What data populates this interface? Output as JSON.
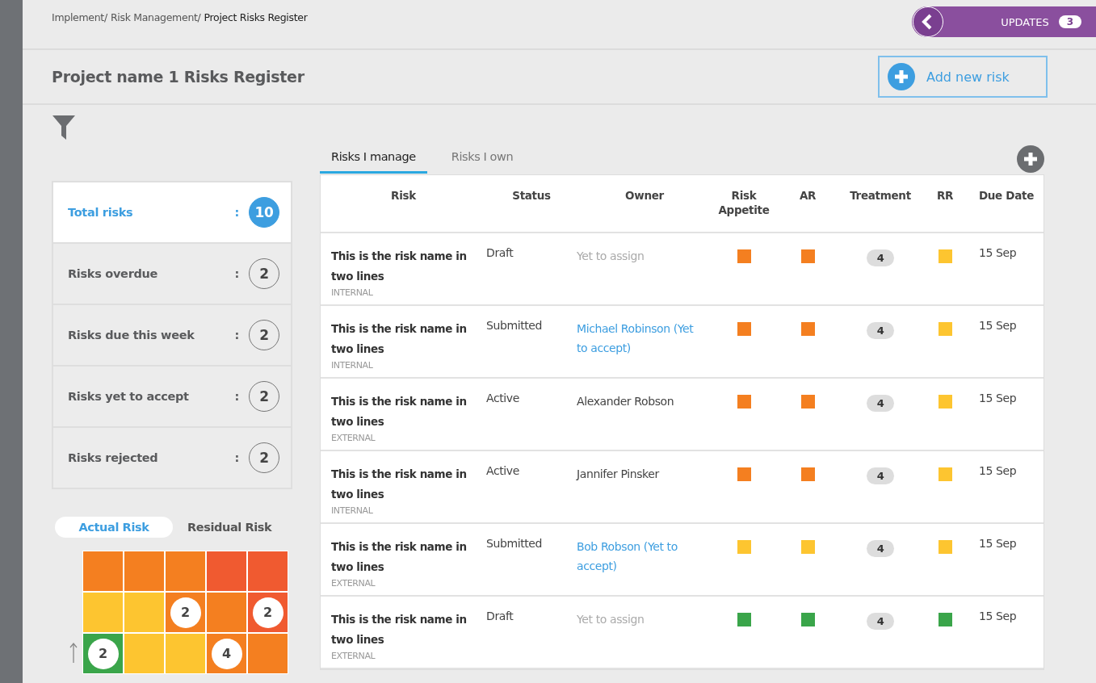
{
  "breadcrumb": {
    "items": [
      "Implement/",
      "Risk Management/"
    ],
    "current": "Project Risks Register"
  },
  "updates": {
    "label": "UPDATES",
    "count": "3"
  },
  "page_title": "Project name 1 Risks Register",
  "add_button": "Add new risk",
  "summary": [
    {
      "label": "Total risks",
      "separator": ":",
      "count": "10",
      "selected": true
    },
    {
      "label": "Risks overdue",
      "separator": ":",
      "count": "2",
      "selected": false
    },
    {
      "label": "Risks due this week",
      "separator": ":",
      "count": "2",
      "selected": false
    },
    {
      "label": "Risks yet to accept",
      "separator": ":",
      "count": "2",
      "selected": false
    },
    {
      "label": "Risks rejected",
      "separator": ":",
      "count": "2",
      "selected": false
    }
  ],
  "heatmap": {
    "toggles": [
      {
        "label": "Actual Risk",
        "selected": true
      },
      {
        "label": "Residual Risk",
        "selected": false
      }
    ],
    "rows": [
      [
        {
          "color": "#f47f20"
        },
        {
          "color": "#f47f20"
        },
        {
          "color": "#f47f20"
        },
        {
          "color": "#f05a30"
        },
        {
          "color": "#f05a30"
        }
      ],
      [
        {
          "color": "#fdc530"
        },
        {
          "color": "#fdc530"
        },
        {
          "color": "#f47f20",
          "count": "2"
        },
        {
          "color": "#f47f20"
        },
        {
          "color": "#f05a30",
          "count": "2"
        }
      ],
      [
        {
          "color": "#3aa54a",
          "count": "2"
        },
        {
          "color": "#fdc530"
        },
        {
          "color": "#fdc530"
        },
        {
          "color": "#f47f20",
          "count": "4"
        },
        {
          "color": "#f47f20"
        }
      ]
    ]
  },
  "tabs": [
    {
      "label": "Risks I manage",
      "selected": true
    },
    {
      "label": "Risks I own",
      "selected": false
    }
  ],
  "table": {
    "columns": [
      "Risk",
      "Status",
      "Owner",
      "Risk Appetite",
      "AR",
      "Treatment",
      "RR",
      "Due Date"
    ],
    "rows": [
      {
        "risk": "This is the risk name in two lines",
        "type": "INTERNAL",
        "status": "Draft",
        "owner": {
          "name": "Yet to assign",
          "kind": "unassigned"
        },
        "appetite": {
          "color": "#f47f20"
        },
        "ar": {
          "color": "#f47f20"
        },
        "treatment": "4",
        "rr": {
          "color": "#fdc530"
        },
        "due": "15 Sep"
      },
      {
        "risk": "This is the risk name in two lines",
        "type": "INTERNAL",
        "status": "Submitted",
        "owner": {
          "name": "Michael Robinson (Yet to accept)",
          "kind": "pending"
        },
        "appetite": {
          "color": "#f47f20"
        },
        "ar": {
          "color": "#f47f20"
        },
        "treatment": "4",
        "rr": {
          "color": "#fdc530"
        },
        "due": "15 Sep"
      },
      {
        "risk": "This is the risk name in two lines",
        "type": "EXTERNAL",
        "status": "Active",
        "owner": {
          "name": "Alexander Robson",
          "kind": "assigned"
        },
        "appetite": {
          "color": "#f47f20"
        },
        "ar": {
          "color": "#f47f20"
        },
        "treatment": "4",
        "rr": {
          "color": "#fdc530"
        },
        "due": "15 Sep"
      },
      {
        "risk": "This is the risk name in two lines",
        "type": "INTERNAL",
        "status": "Active",
        "owner": {
          "name": "Jannifer Pinsker",
          "kind": "assigned"
        },
        "appetite": {
          "color": "#f47f20"
        },
        "ar": {
          "color": "#f47f20"
        },
        "treatment": "4",
        "rr": {
          "color": "#fdc530"
        },
        "due": "15 Sep"
      },
      {
        "risk": "This is the risk name in two lines",
        "type": "EXTERNAL",
        "status": "Submitted",
        "owner": {
          "name": "Bob Robson (Yet to accept)",
          "kind": "pending"
        },
        "appetite": {
          "color": "#fdc530"
        },
        "ar": {
          "color": "#fdc530"
        },
        "treatment": "4",
        "rr": {
          "color": "#fdc530"
        },
        "due": "15 Sep"
      },
      {
        "risk": "This is the risk name in two lines",
        "type": "EXTERNAL",
        "status": "Draft",
        "owner": {
          "name": "Yet to assign",
          "kind": "unassigned"
        },
        "appetite": {
          "color": "#3aa54a"
        },
        "ar": {
          "color": "#3aa54a"
        },
        "treatment": "4",
        "rr": {
          "color": "#3aa54a"
        },
        "due": "15 Sep"
      }
    ]
  }
}
